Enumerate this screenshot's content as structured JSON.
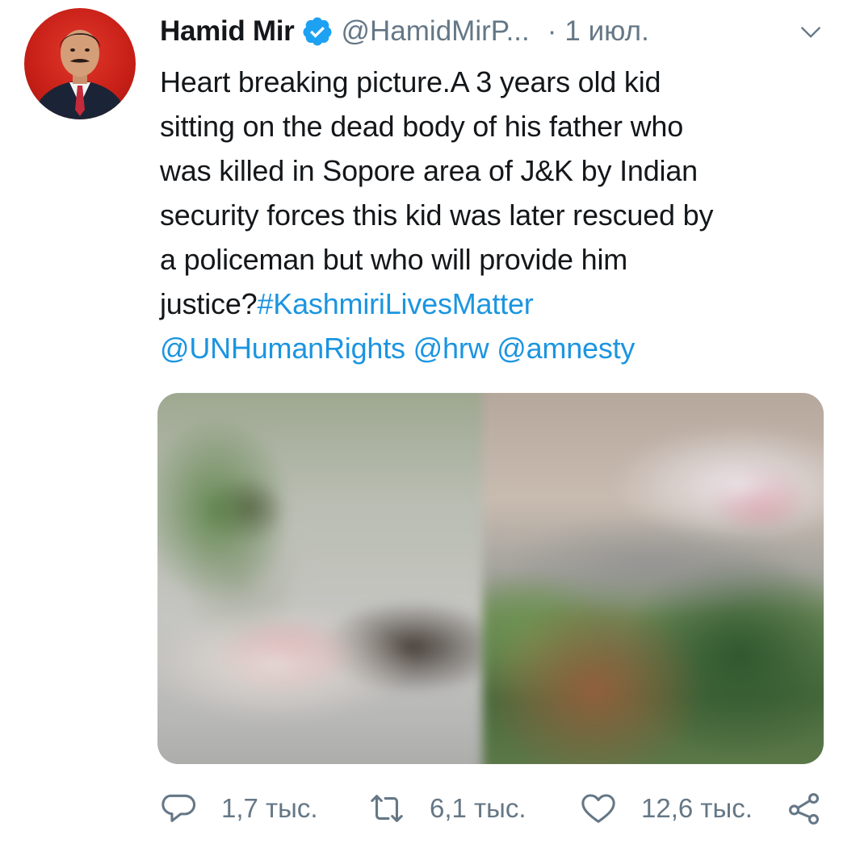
{
  "tweet": {
    "author_name": "Hamid Mir",
    "handle": "@HamidMirP...",
    "separator": "·",
    "timestamp": "1 июл.",
    "verified": true,
    "avatar_icon": "profile-photo",
    "text_lines": [
      "Heart breaking picture.A 3 years old kid",
      "sitting on the dead body of his father who",
      "was killed in Sopore area of J&K by Indian",
      "security forces this kid was later rescued by",
      "a policeman but who will provide him"
    ],
    "last_line_prefix": "justice?",
    "hashtag": "#KashmiriLivesMatter",
    "mentions": [
      "@UNHumanRights",
      "@hrw",
      "@amnesty"
    ],
    "media_count": 2,
    "actions": {
      "replies": "1,7 тыс.",
      "retweets": "6,1 тыс.",
      "likes": "12,6 тыс."
    },
    "colors": {
      "link": "#1b95e0",
      "secondary_text": "#657786",
      "verified_badge": "#1da1f2",
      "primary_text": "#14171a"
    },
    "icons": {
      "verified": "verified-badge-icon",
      "caret": "chevron-down-icon",
      "reply": "reply-icon",
      "retweet": "retweet-icon",
      "like": "heart-icon",
      "share": "share-icon"
    }
  }
}
